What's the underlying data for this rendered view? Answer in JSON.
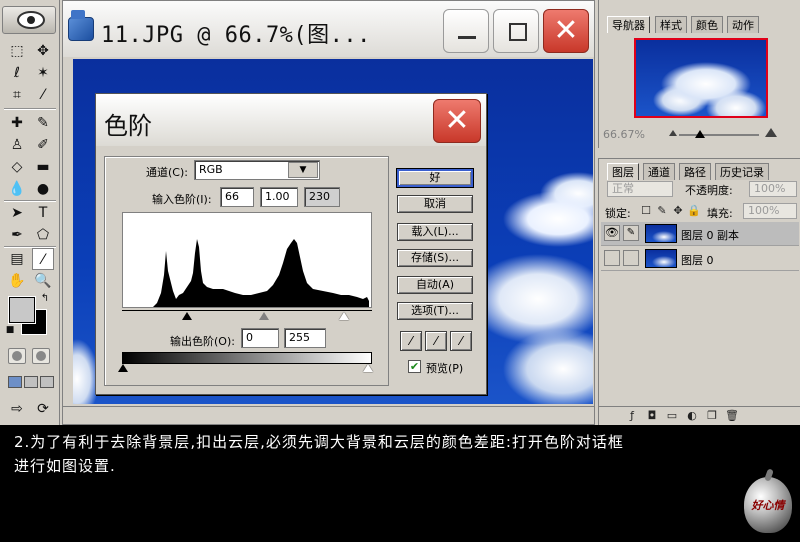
{
  "document": {
    "title": "11.JPG @ 66.7%(图..."
  },
  "levels_dialog": {
    "title": "色阶",
    "channel_label": "通道(C):",
    "channel_value": "RGB",
    "input_label": "输入色阶(I):",
    "input_black": "66",
    "input_gamma": "1.00",
    "input_white": "230",
    "output_label": "输出色阶(O):",
    "output_black": "0",
    "output_white": "255",
    "buttons": {
      "ok": "好",
      "cancel": "取消",
      "load": "载入(L)...",
      "save": "存储(S)...",
      "auto": "自动(A)",
      "options": "选项(T)..."
    },
    "preview_label": "预览(P)",
    "preview_checked": true
  },
  "navigator_panel": {
    "tabs": [
      "导航器",
      "样式",
      "颜色",
      "动作"
    ],
    "zoom": "66.67%"
  },
  "layers_panel": {
    "tabs": [
      "图层",
      "通道",
      "路径",
      "历史记录"
    ],
    "blend_mode": "正常",
    "opacity_label": "不透明度:",
    "opacity_value": "100%",
    "lock_label": "锁定:",
    "fill_label": "填充:",
    "fill_value": "100%",
    "layers": [
      {
        "name": "图层 0 副本",
        "visible": true,
        "active": true
      },
      {
        "name": "图层 0",
        "visible": false,
        "active": false
      }
    ]
  },
  "caption": {
    "line1": "2.为了有利于去除背景层,扣出云层,必须先调大背景和云层的颜色差距:打开色阶对话框",
    "line2": "进行如图设置.",
    "logo_text": "好心情"
  },
  "colors": {
    "close_red": "#d9473a",
    "sky_blue": "#0b3fb8",
    "panel_gray": "#d4d0c8"
  }
}
